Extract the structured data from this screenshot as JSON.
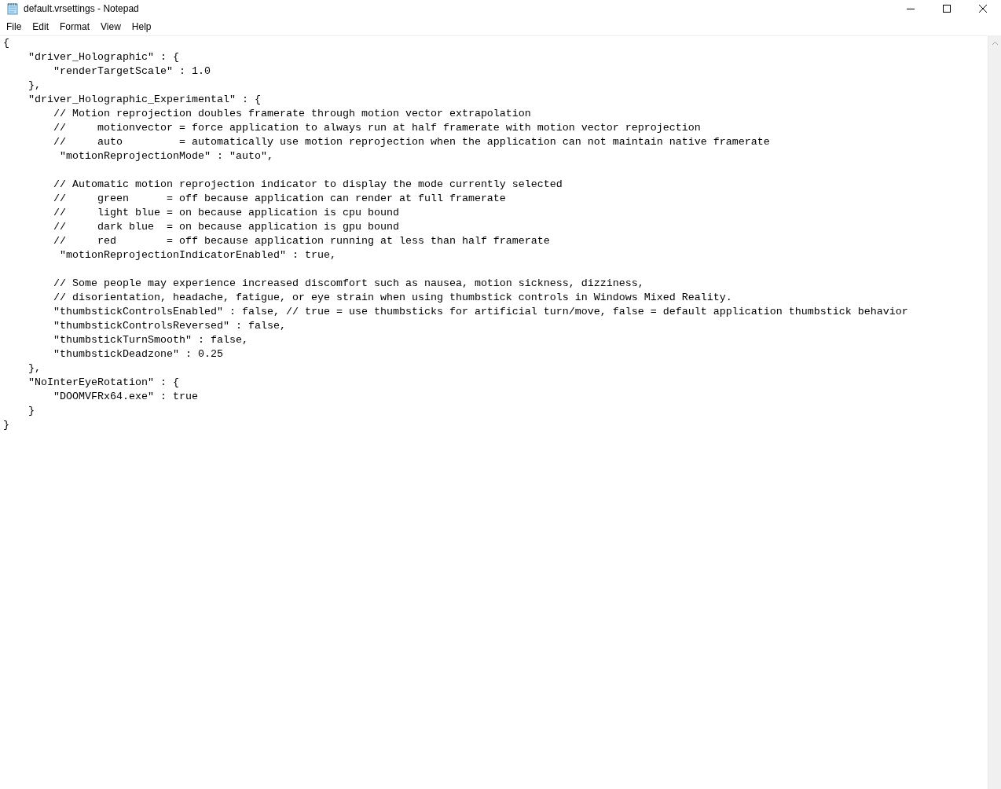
{
  "window": {
    "title": "default.vrsettings - Notepad"
  },
  "menu": [
    "File",
    "Edit",
    "Format",
    "View",
    "Help"
  ],
  "editor": {
    "blocks": [
      [
        "{",
        "    \"driver_Holographic\" : {",
        "        \"renderTargetScale\" : 1.0",
        "    },",
        "    \"driver_Holographic_Experimental\" : {",
        "        // Motion reprojection doubles framerate through motion vector extrapolation",
        "        //     motionvector = force application to always run at half framerate with motion vector reprojection",
        "        //     auto         = automatically use motion reprojection when the application can not maintain native framerate",
        "         \"motionReprojectionMode\" : \"auto\","
      ],
      [
        "        // Automatic motion reprojection indicator to display the mode currently selected",
        "        //     green      = off because application can render at full framerate",
        "        //     light blue = on because application is cpu bound",
        "        //     dark blue  = on because application is gpu bound",
        "        //     red        = off because application running at less than half framerate",
        "         \"motionReprojectionIndicatorEnabled\" : true,"
      ],
      [
        "        // Some people may experience increased discomfort such as nausea, motion sickness, dizziness,",
        "        // disorientation, headache, fatigue, or eye strain when using thumbstick controls in Windows Mixed Reality.",
        "        \"thumbstickControlsEnabled\" : false, // true = use thumbsticks for artificial turn/move, false = default application thumbstick behavior",
        "        \"thumbstickControlsReversed\" : false,",
        "        \"thumbstickTurnSmooth\" : false,",
        "        \"thumbstickDeadzone\" : 0.25",
        "    },",
        "    \"NoInterEyeRotation\" : {",
        "        \"DOOMVFRx64.exe\" : true",
        "    }",
        "}"
      ]
    ]
  }
}
